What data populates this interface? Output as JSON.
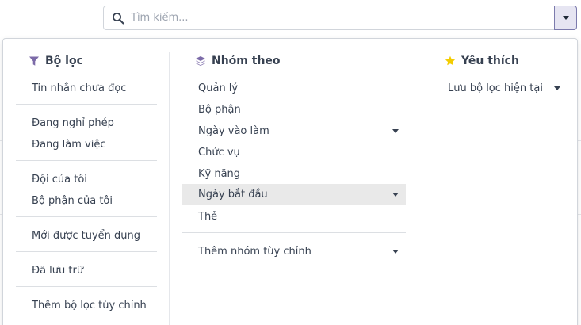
{
  "search": {
    "placeholder": "Tìm kiếm..."
  },
  "filters": {
    "header": "Bộ lọc",
    "groups": [
      [
        "Tin nhắn chưa đọc"
      ],
      [
        "Đang nghỉ phép",
        "Đang làm việc"
      ],
      [
        "Đội của tôi",
        "Bộ phận của tôi"
      ],
      [
        "Mới được tuyển dụng"
      ],
      [
        "Đã lưu trữ"
      ],
      [
        "Thêm bộ lọc tùy chỉnh"
      ]
    ]
  },
  "groupby": {
    "header": "Nhóm theo",
    "items": [
      "Quản lý",
      "Bộ phận",
      "Ngày vào làm",
      "Chức vụ",
      "Kỹ năng",
      "Ngày bắt đầu",
      "Thẻ"
    ],
    "add_custom": "Thêm nhóm tùy chỉnh",
    "highlighted": "Ngày bắt đầu"
  },
  "favorites": {
    "header": "Yêu thích",
    "save_filter": "Lưu bộ lọc hiện tại"
  },
  "colors": {
    "filter_icon": "#7c6ba8",
    "groupby_icon": "#7c6ba8",
    "star_icon": "#f3cc00",
    "accent": "#7c7bad",
    "highlight_row": "#e9e9e9"
  },
  "icons": {
    "search": "search-icon",
    "toggle": "caret-down-icon",
    "filters": "funnel-icon",
    "groupby": "layers-icon",
    "favorites": "star-icon",
    "submenu": "caret-down-icon"
  }
}
